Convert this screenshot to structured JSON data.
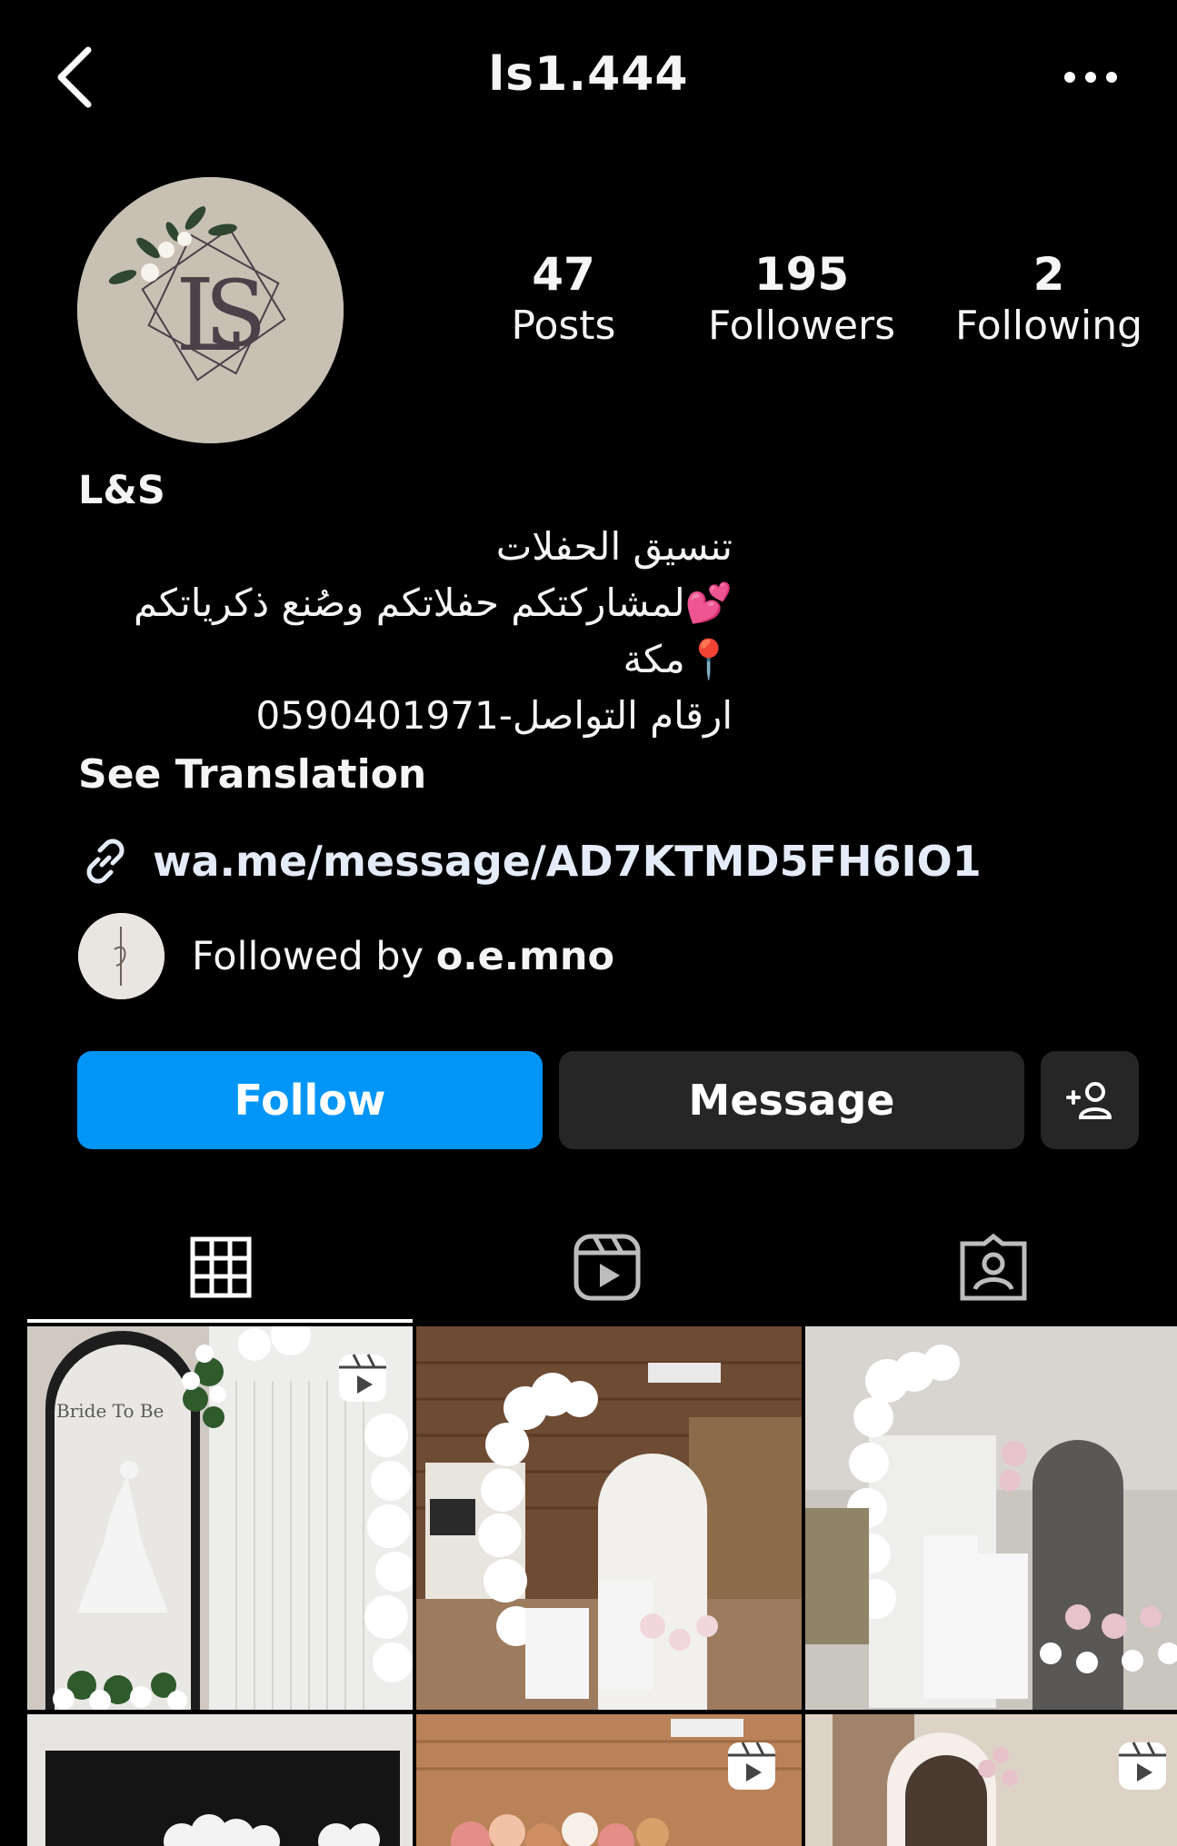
{
  "header": {
    "username": "ls1.444",
    "back_icon": "chevron-left-icon",
    "more_icon": "more-horizontal-icon"
  },
  "stats": {
    "posts": {
      "count": "47",
      "label": "Posts"
    },
    "followers": {
      "count": "195",
      "label": "Followers"
    },
    "following": {
      "count": "2",
      "label": "Following"
    }
  },
  "bio": {
    "name": "L&S",
    "line1": "تنسيق الحفلات",
    "line2": "💕لمشاركتكم حفلاتكم وصُنع ذكرياتكم",
    "line3": "📍مكة",
    "line4": "ارقام التواصل-0590401971",
    "see_translation": "See Translation"
  },
  "link": {
    "text": "wa.me/message/AD7KTMD5FH6IO1",
    "icon": "link-icon"
  },
  "followed_by": {
    "prefix": "Followed by ",
    "user": "o.e.mno"
  },
  "buttons": {
    "follow": "Follow",
    "message": "Message",
    "add_icon": "add-person-icon"
  },
  "tabs": [
    {
      "icon": "grid-icon",
      "active": true
    },
    {
      "icon": "reels-icon",
      "active": false
    },
    {
      "icon": "tagged-icon",
      "active": false
    }
  ],
  "posts": [
    {
      "caption": "Bride To Be",
      "is_reel": true
    },
    {
      "caption": "",
      "is_reel": false
    },
    {
      "caption": "",
      "is_reel": false
    },
    {
      "caption": "",
      "is_reel": false
    },
    {
      "caption": "",
      "is_reel": true
    },
    {
      "caption": "",
      "is_reel": true
    }
  ],
  "colors": {
    "background": "#000000",
    "follow_button": "#0095f6",
    "secondary_button": "#262626",
    "link_text": "#e3ecf8"
  }
}
